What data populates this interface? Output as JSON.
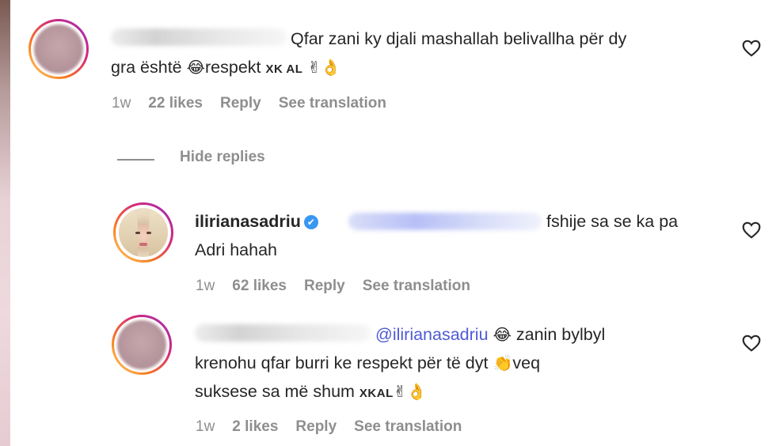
{
  "comments": [
    {
      "text_a": "Qfar zani ky djali mashallah belivallha për dy",
      "text_b_pre": "gra është ",
      "emoji_1": "😂",
      "text_b_post": "respekt ",
      "caps": "XK AL",
      "emoji_2": "✌",
      "emoji_3": "👌",
      "time": "1w",
      "likes": "22 likes",
      "reply": "Reply",
      "translate": "See translation"
    }
  ],
  "hide_replies": "Hide replies",
  "replies": [
    {
      "username": "ilirianasadriu",
      "verified_icon": "✔",
      "text_a": "fshije sa se ka pa",
      "text_b": "Adri hahah",
      "time": "1w",
      "likes": "62 likes",
      "reply": "Reply",
      "translate": "See translation"
    },
    {
      "mention": "@ilirianasadriu",
      "emoji_1": "😂",
      "text_a": "zanin bylbyl",
      "text_b": "krenohu qfar burri ke respekt për të dyt ",
      "emoji_2": "👏",
      "text_b_post": "veq",
      "text_c": "suksese sa më shum ",
      "caps": "XKAL",
      "emoji_3": "✌",
      "emoji_4": "👌",
      "time": "1w",
      "likes": "2 likes",
      "reply": "Reply",
      "translate": "See translation"
    }
  ]
}
